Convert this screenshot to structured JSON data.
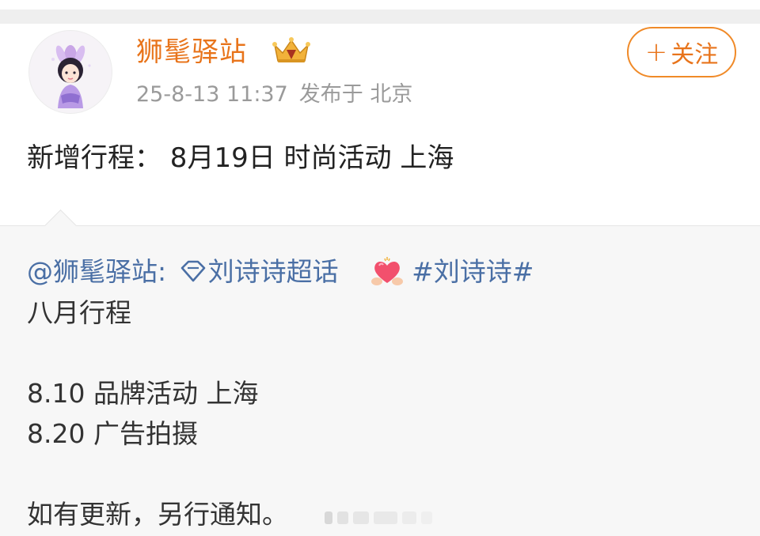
{
  "post": {
    "username": "狮髦驿站",
    "timestamp": "25-8-13 11:37",
    "location": "发布于 北京",
    "follow_plus": "+",
    "follow_label": "关注",
    "text": "新增行程： 8月19日 时尚活动 上海"
  },
  "repost": {
    "mention": "@狮髦驿站:",
    "super_topic": "刘诗诗超话",
    "hashtag": "#刘诗诗#",
    "lines": [
      "八月行程",
      "",
      "8.10 品牌活动 上海",
      "8.20 广告拍摄",
      "",
      "如有更新，另行通知。"
    ]
  },
  "colors": {
    "accent": "#e8741b",
    "link": "#4a6fa5",
    "meta": "#9a9a9a",
    "repost_bg": "#f7f7f7"
  },
  "icons": {
    "vip": "crown-badge-icon",
    "super_topic": "diamond-icon",
    "emoji": "heart-hands-emoji-icon"
  }
}
